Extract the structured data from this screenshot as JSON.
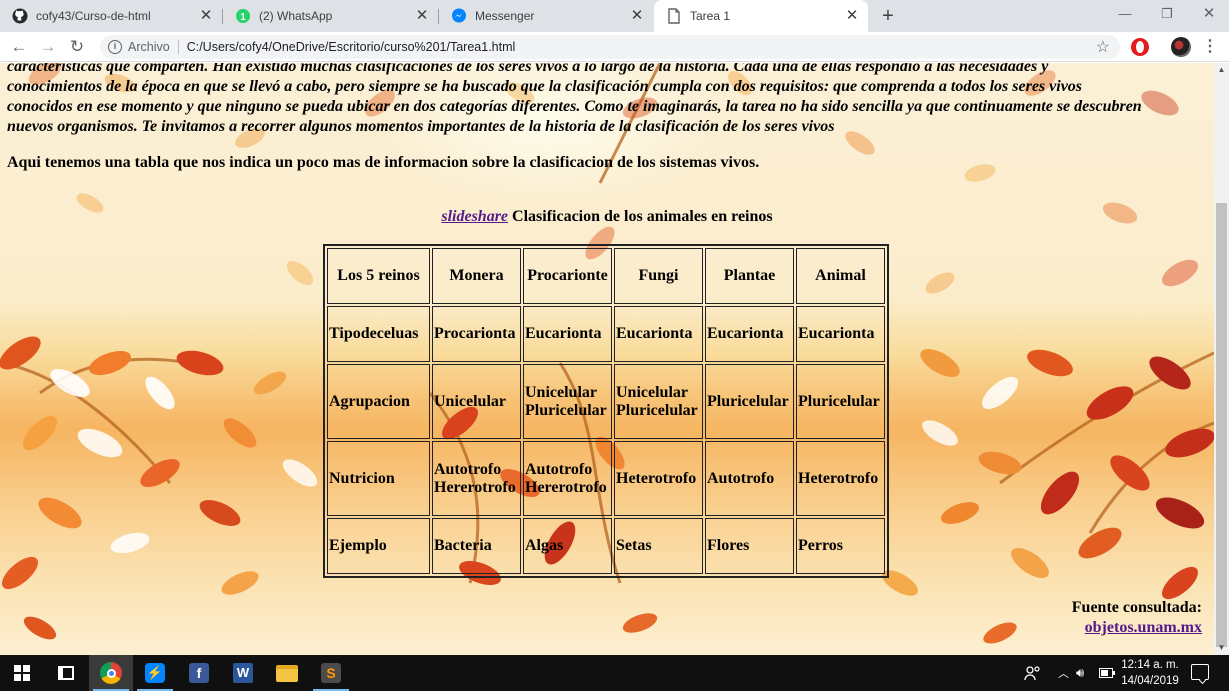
{
  "browser": {
    "tabs": [
      {
        "title": "cofy43/Curso-de-html",
        "icon": "github-icon",
        "active": false
      },
      {
        "title": "(2) WhatsApp",
        "icon": "whatsapp-icon",
        "active": false
      },
      {
        "title": "Messenger",
        "icon": "messenger-icon",
        "active": false
      },
      {
        "title": "Tarea 1",
        "icon": "document-icon",
        "active": true
      }
    ],
    "address": {
      "scheme_label": "Archivo",
      "url": "C:/Users/cofy4/OneDrive/Escritorio/curso%201/Tarea1.html"
    }
  },
  "page": {
    "intro_lines": [
      "características que comparten. Han existido muchas clasificaciones de los seres vivos a lo largo de la historia. Cada una de ellas respondió a las necesidades y",
      "conocimientos de la época en que se llevó a cabo, pero siempre se ha buscado que la clasificación cumpla con dos requisitos: que comprenda a todos los seres vivos",
      "conocidos en ese momento y que ninguno se pueda ubicar en dos categorías diferentes. Como te imaginarás, la tarea no ha sido sencilla ya que continuamente se descubren",
      "nuevos organismos. Te invitamos a recorrer algunos momentos importantes de la historia de la clasificación de los seres vivos"
    ],
    "lead": "Aqui tenemos una tabla que nos indica un poco mas de informacion sobre la clasificacion de los sistemas vivos.",
    "caption_link": "slideshare",
    "caption_text": "Clasificacion de los animales en reinos",
    "table": [
      [
        "Los 5 reinos",
        "Monera",
        "Procarionte",
        "Fungi",
        "Plantae",
        "Animal"
      ],
      [
        "Tipodeceluas",
        "Procarionta",
        "Eucarionta",
        "Eucarionta",
        "Eucarionta",
        "Eucarionta"
      ],
      [
        "Agrupacion",
        "Unicelular",
        "Unicelular Pluricelular",
        "Unicelular Pluricelular",
        "Pluricelular",
        "Pluricelular"
      ],
      [
        "Nutricion",
        "Autotrofo Hererotrofo",
        "Autotrofo Hererotrofo",
        "Heterotrofo",
        "Autotrofo",
        "Heterotrofo"
      ],
      [
        "Ejemplo",
        "Bacteria",
        "Algas",
        "Setas",
        "Flores",
        "Perros"
      ]
    ],
    "source_label": "Fuente consultada:",
    "source_link": "objetos.unam.mx"
  },
  "taskbar": {
    "clock_time": "12:14 a. m.",
    "clock_date": "14/04/2019"
  }
}
